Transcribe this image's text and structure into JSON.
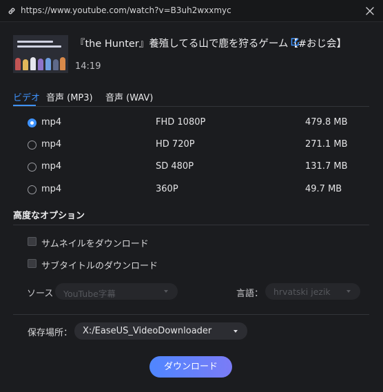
{
  "window": {
    "url": "https://www.youtube.com/watch?v=B3uh2wxxmyc",
    "link_icon": "link-icon",
    "close_icon": "close-icon"
  },
  "video": {
    "title": "『the Hunter』養殖してる山で鹿を狩るゲーム【#おじ会】",
    "duration": "14:19",
    "edit_icon": "edit-icon"
  },
  "tabs": [
    {
      "label": "ビデオ",
      "active": true
    },
    {
      "label": "音声 (MP3)",
      "active": false
    },
    {
      "label": "音声 (WAV)",
      "active": false
    }
  ],
  "formats": [
    {
      "format": "mp4",
      "quality": "FHD 1080P",
      "size": "479.8 MB",
      "selected": true
    },
    {
      "format": "mp4",
      "quality": "HD 720P",
      "size": "271.1 MB",
      "selected": false
    },
    {
      "format": "mp4",
      "quality": "SD 480P",
      "size": "131.7 MB",
      "selected": false
    },
    {
      "format": "mp4",
      "quality": "360P",
      "size": "49.7 MB",
      "selected": false
    }
  ],
  "advanced": {
    "title": "高度なオプション",
    "thumbnail_label": "サムネイルをダウンロード",
    "subtitle_label": "サブタイトルのダウンロード",
    "source_label": "ソース",
    "source_value": "YouTube字幕",
    "language_label": "言語：",
    "language_value": "hrvatski jezik"
  },
  "save": {
    "label": "保存場所：",
    "path": "X:/EaseUS_VideoDownloader"
  },
  "download_button": "ダウンロード",
  "colors": {
    "accent": "#3f93ff",
    "background": "#1b1c1f",
    "button_gradient_start": "#4f86ff",
    "button_gradient_end": "#7b7cf6"
  }
}
